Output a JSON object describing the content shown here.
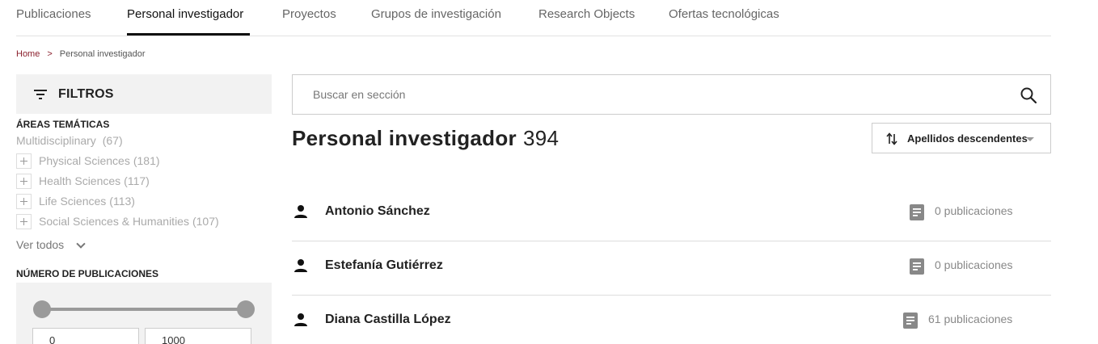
{
  "nav": {
    "tabs": [
      {
        "label": "Publicaciones",
        "active": false
      },
      {
        "label": "Personal investigador",
        "active": true
      },
      {
        "label": "Proyectos",
        "active": false
      },
      {
        "label": "Grupos de investigación",
        "active": false
      },
      {
        "label": "Research Objects",
        "active": false
      },
      {
        "label": "Ofertas tecnológicas",
        "active": false
      }
    ]
  },
  "breadcrumb": {
    "home": "Home",
    "separator": ">",
    "current": "Personal investigador"
  },
  "sidebar": {
    "filters_title": "FILTROS",
    "filters_icon": "filter-icon",
    "areas": {
      "title": "ÁREAS TEMÁTICAS",
      "multidisciplinary": {
        "label": "Multidisciplinary",
        "count": "(67)"
      },
      "items": [
        {
          "label": "Physical Sciences",
          "count": "(181)"
        },
        {
          "label": "Health Sciences",
          "count": "(117)"
        },
        {
          "label": "Life Sciences",
          "count": "(113)"
        },
        {
          "label": "Social Sciences & Humanities",
          "count": "(107)"
        }
      ],
      "ver_todos": "Ver todos"
    },
    "publications": {
      "title": "NÚMERO DE PUBLICACIONES",
      "min": "0",
      "max": "1000",
      "range_fraction": [
        0,
        1
      ]
    }
  },
  "search": {
    "placeholder": "Buscar en sección",
    "value": "",
    "icon": "search-icon"
  },
  "main": {
    "title": "Personal investigador",
    "count": "394",
    "sort": {
      "label": "Apellidos descendentes",
      "icon": "sort-icon"
    }
  },
  "results": [
    {
      "name": "Antonio Sánchez",
      "publications": "0 publicaciones"
    },
    {
      "name": "Estefanía Gutiérrez",
      "publications": "0 publicaciones"
    },
    {
      "name": "Diana Castilla López",
      "publications": "61 publicaciones"
    }
  ],
  "colors": {
    "accent": "#8a1f2c",
    "text": "#222222",
    "muted": "#aaaaaa",
    "panel": "#f2f2f2"
  }
}
